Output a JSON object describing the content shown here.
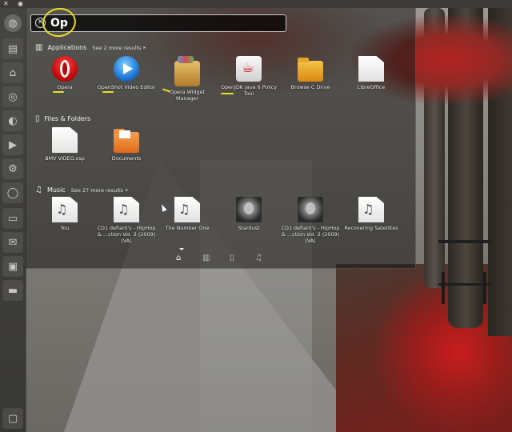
{
  "search": {
    "query": "Op",
    "clear_icon": "close-circle-icon"
  },
  "applications": {
    "heading": "Applications",
    "more": "See 2 more results",
    "icon": "applications-icon",
    "items": [
      {
        "label": "Opera",
        "icon": "opera-icon"
      },
      {
        "label": "OpenShot Video Editor",
        "icon": "openshot-icon"
      },
      {
        "label": "Opera Widget Manager",
        "icon": "opera-widget-icon"
      },
      {
        "label": "OpenJDK Java 6 Policy Tool",
        "icon": "java-icon"
      },
      {
        "label": "Browse C Drive",
        "icon": "folder-icon"
      },
      {
        "label": "LibreOffice",
        "icon": "libreoffice-icon"
      }
    ]
  },
  "files": {
    "heading": "Files & Folders",
    "icon": "files-icon",
    "items": [
      {
        "label": "BMV VIDEO.osp",
        "icon": "document-icon"
      },
      {
        "label": "Documents",
        "icon": "documents-folder-icon"
      }
    ]
  },
  "music": {
    "heading": "Music",
    "more": "See 27 more results",
    "icon": "music-note-icon",
    "items": [
      {
        "label": "You",
        "icon": "music-file-icon"
      },
      {
        "label": "CD1 defiant's - HipHop & …ction Vol. 2 (2009) (VA)",
        "icon": "music-file-icon"
      },
      {
        "label": "The Number One",
        "icon": "music-file-icon"
      },
      {
        "label": "Stardust",
        "icon": "album-art-icon"
      },
      {
        "label": "CD1 defiant's - HipHop & …ction Vol. 2 (2009) (VA)",
        "icon": "album-art-icon"
      },
      {
        "label": "Recovering Satellites",
        "icon": "music-file-icon"
      }
    ]
  },
  "lenses": [
    "home-lens-icon",
    "applications-lens-icon",
    "files-lens-icon",
    "music-lens-icon"
  ],
  "launcher": [
    "bfb-icon",
    "files-icon",
    "home-folder-icon",
    "firefox-icon",
    "chromium-icon",
    "media-icon",
    "settings-icon",
    "globe-icon",
    "terminal-icon",
    "mail-icon",
    "window-icon",
    "drive-icon",
    "trash-icon"
  ],
  "colors": {
    "annotation": "#e8e020",
    "dash_bg": "#1c1a18"
  }
}
